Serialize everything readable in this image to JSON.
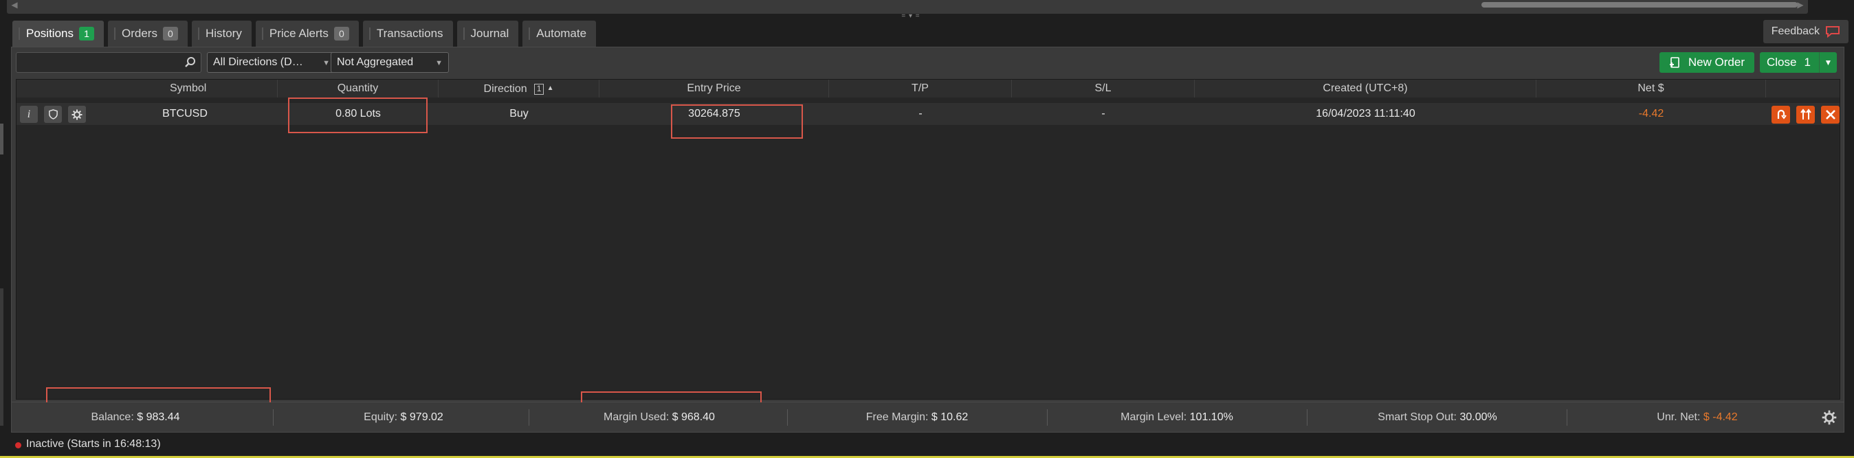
{
  "tabs": [
    {
      "label": "Positions",
      "badge": "1",
      "badge_color": "#1f9f4f"
    },
    {
      "label": "Orders",
      "badge": "0"
    },
    {
      "label": "History"
    },
    {
      "label": "Price Alerts",
      "badge": "0"
    },
    {
      "label": "Transactions"
    },
    {
      "label": "Journal"
    },
    {
      "label": "Automate"
    }
  ],
  "feedback_label": "Feedback",
  "toolbar": {
    "search_value": "",
    "direction_filter": "All Directions (D…",
    "aggregation_filter": "Not Aggregated",
    "new_order_label": "New Order",
    "close_label": "Close",
    "close_count": "1"
  },
  "columns": {
    "symbol": "Symbol",
    "quantity": "Quantity",
    "direction": "Direction",
    "direction_sort_index": "1",
    "entry_price": "Entry Price",
    "tp": "T/P",
    "sl": "S/L",
    "created": "Created (UTC+8)",
    "net": "Net $"
  },
  "positions": [
    {
      "symbol": "BTCUSD",
      "quantity": "0.80 Lots",
      "direction": "Buy",
      "entry_price": "30264.875",
      "tp": "-",
      "sl": "-",
      "created": "16/04/2023 11:11:40",
      "net": "-4.42"
    }
  ],
  "account": {
    "balance_label": "Balance:",
    "balance_value": "$ 983.44",
    "equity_label": "Equity:",
    "equity_value": "$ 979.02",
    "margin_used_label": "Margin Used:",
    "margin_used_value": "$ 968.40",
    "free_margin_label": "Free Margin:",
    "free_margin_value": "$ 10.62",
    "margin_level_label": "Margin Level:",
    "margin_level_value": "101.10%",
    "smart_stop_out_label": "Smart Stop Out:",
    "smart_stop_out_value": "30.00%",
    "unr_net_label": "Unr. Net:",
    "unr_net_value": "$ -4.42"
  },
  "status": {
    "text": "Inactive (Starts in 16:48:13)",
    "dot_color": "#d42c2c"
  },
  "colors": {
    "accent_green": "#1e8d43",
    "negative_orange": "#e8792c",
    "action_orange": "#e05216",
    "highlight_red": "#d9574a"
  }
}
